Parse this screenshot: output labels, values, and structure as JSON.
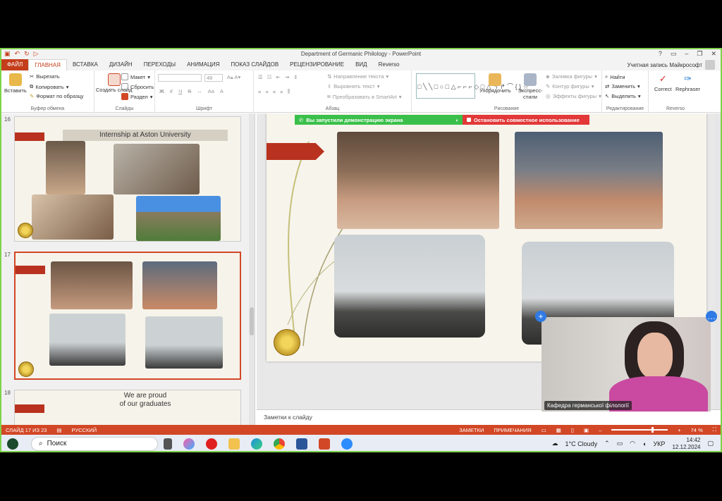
{
  "window": {
    "title": "Department of Germanic Philology - PowerPoint",
    "account": "Учетная запись Майкрософт",
    "help": "?"
  },
  "tabs": [
    "ФАЙЛ",
    "ГЛАВНАЯ",
    "ВСТАВКА",
    "ДИЗАЙН",
    "ПЕРЕХОДЫ",
    "АНИМАЦИЯ",
    "ПОКАЗ СЛАЙДОВ",
    "РЕЦЕНЗИРОВАНИЕ",
    "ВИД",
    "Reverso"
  ],
  "ribbon": {
    "clipboard": {
      "paste": "Вставить",
      "cut": "Вырезать",
      "copy": "Копировать",
      "format_painter": "Формат по образцу",
      "label": "Буфер обмена"
    },
    "slides": {
      "new_slide": "Создать слайд",
      "layout": "Макет",
      "reset": "Сбросить",
      "section": "Раздел",
      "label": "Слайды"
    },
    "font": {
      "size": "48",
      "bold": "Ж",
      "italic": "К",
      "underline": "Ч",
      "strike": "S",
      "case": "Aa",
      "label": "Шрифт"
    },
    "paragraph": {
      "text_direction": "Направление текста",
      "align_text": "Выровнять текст",
      "smartart": "Преобразовать в SmartArt",
      "label": "Абзац"
    },
    "drawing": {
      "arrange": "Упорядочить",
      "quick_styles": "Экспресс-стили",
      "shape_fill": "Заливка фигуры",
      "shape_outline": "Контур фигуры",
      "shape_effects": "Эффекты фигуры",
      "label": "Рисование"
    },
    "editing": {
      "find": "Найти",
      "replace": "Заменить",
      "select": "Выделить",
      "label": "Редактирование"
    },
    "reverso": {
      "correct": "Correct",
      "rephraser": "Rephraser",
      "label": "Reverso"
    }
  },
  "slides": [
    {
      "number": "16",
      "title": "Internship at Aston University"
    },
    {
      "number": "17"
    },
    {
      "number": "18",
      "title_line1": "We are proud",
      "title_line2": "of our graduates"
    }
  ],
  "share_bar": {
    "started": "Вы запустили демонстрацию экрана",
    "stop": "Остановить совместное использование"
  },
  "notes_placeholder": "Заметки к слайду",
  "video": {
    "name": "Кафедра германської філології"
  },
  "status": {
    "slide": "СЛАЙД 17 ИЗ 23",
    "language": "РУССКИЙ",
    "notes": "ЗАМЕТКИ",
    "comments": "ПРИМЕЧАНИЯ",
    "zoom": "74 %",
    "zoom_level": 0.74
  },
  "taskbar": {
    "search": "Поиск",
    "weather": "1°C  Cloudy",
    "lang": "УКР",
    "time": "14:42",
    "date": "12.12.2024"
  },
  "colors": {
    "accent": "#d24726",
    "share_green": "#3ac04a",
    "share_red": "#e23838"
  }
}
